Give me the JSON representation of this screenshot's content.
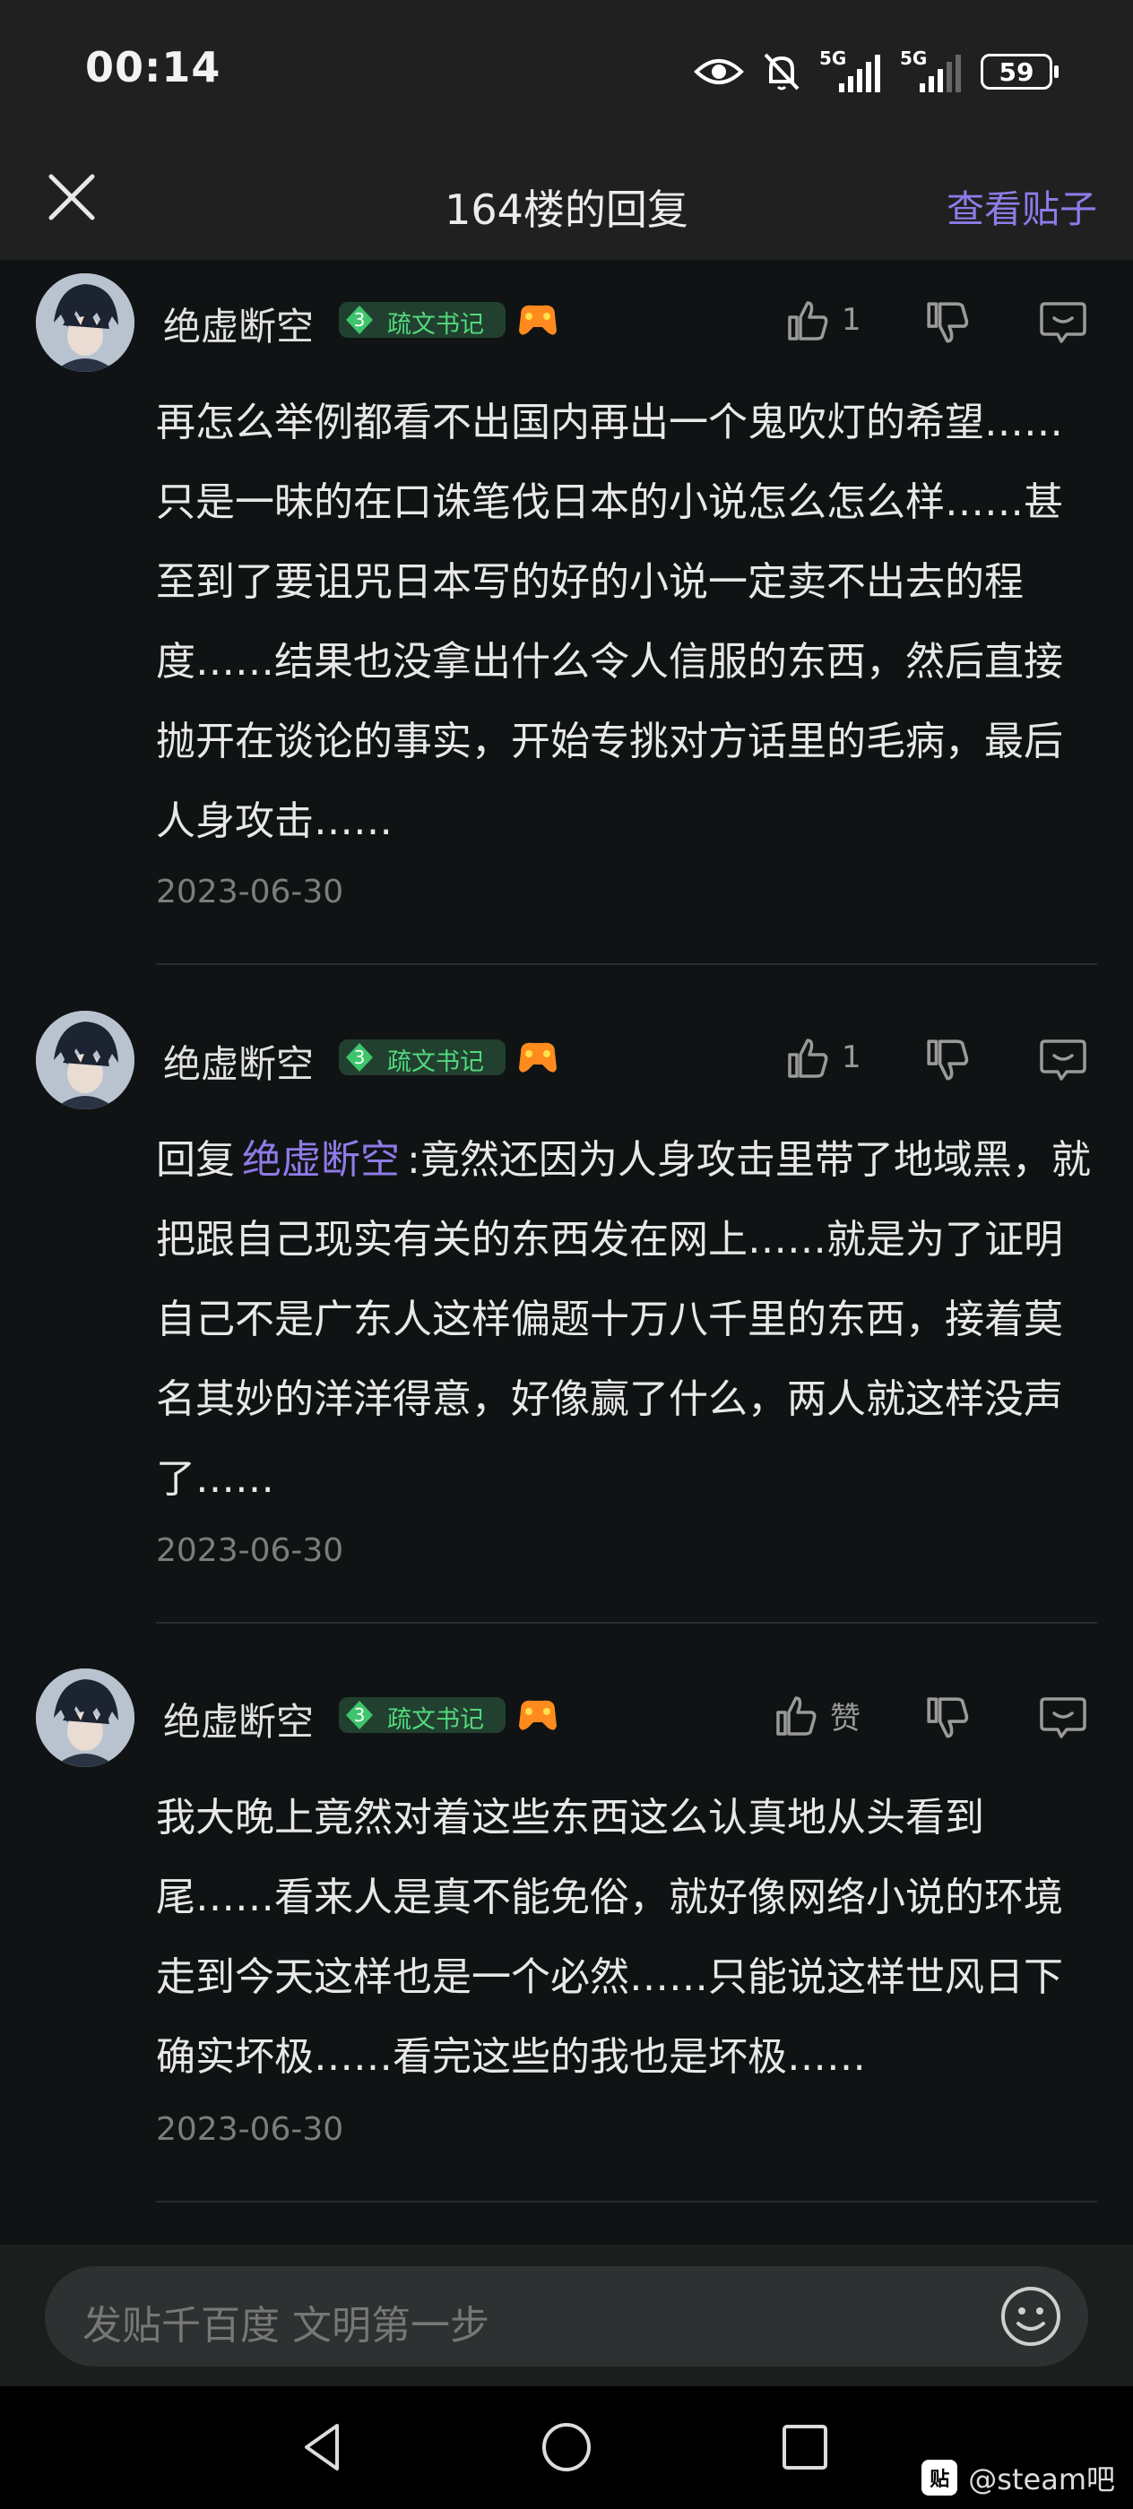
{
  "status_bar": {
    "time": "00:14",
    "net1": "5G",
    "net2": "5G",
    "battery": "59",
    "icons": [
      "eye-icon",
      "mute-bell-icon",
      "signal-icon",
      "signal-icon",
      "battery-icon"
    ]
  },
  "header": {
    "title": "164楼的回复",
    "view_post": "查看贴子"
  },
  "replies": [
    {
      "user": "绝虚断空",
      "level": "3",
      "badge": "疏文书记",
      "likes": "1",
      "text": "再怎么举例都看不出国内再出一个鬼吹灯的希望……只是一昧的在口诛笔伐日本的小说怎么怎么样……甚至到了要诅咒日本写的好的小说一定卖不出去的程度……结果也没拿出什么令人信服的东西，然后直接抛开在谈论的事实，开始专挑对方话里的毛病，最后人身攻击……",
      "date": "2023-06-30"
    },
    {
      "user": "绝虚断空",
      "level": "3",
      "badge": "疏文书记",
      "likes": "1",
      "reply_prefix": "回复",
      "mention": "绝虚断空",
      "text": ":竟然还因为人身攻击里带了地域黑，就把跟自己现实有关的东西发在网上……就是为了证明自己不是广东人这样偏题十万八千里的东西，接着莫名其妙的洋洋得意，好像赢了什么，两人就这样没声了……",
      "date": "2023-06-30"
    },
    {
      "user": "绝虚断空",
      "level": "3",
      "badge": "疏文书记",
      "likes": "赞",
      "text": "我大晚上竟然对着这些东西这么认真地从头看到尾……看来人是真不能免俗，就好像网络小说的环境走到今天这样也是一个必然……只能说这样世风日下确实坏极……看完这些的我也是坏极……",
      "date": "2023-06-30"
    }
  ],
  "input": {
    "placeholder": "发贴千百度 文明第一步"
  },
  "watermark": {
    "logo": "贴",
    "text": "@steam吧"
  },
  "colors": {
    "accent": "#8f7be8",
    "badge_green": "#53d97e",
    "background": "#101313"
  }
}
